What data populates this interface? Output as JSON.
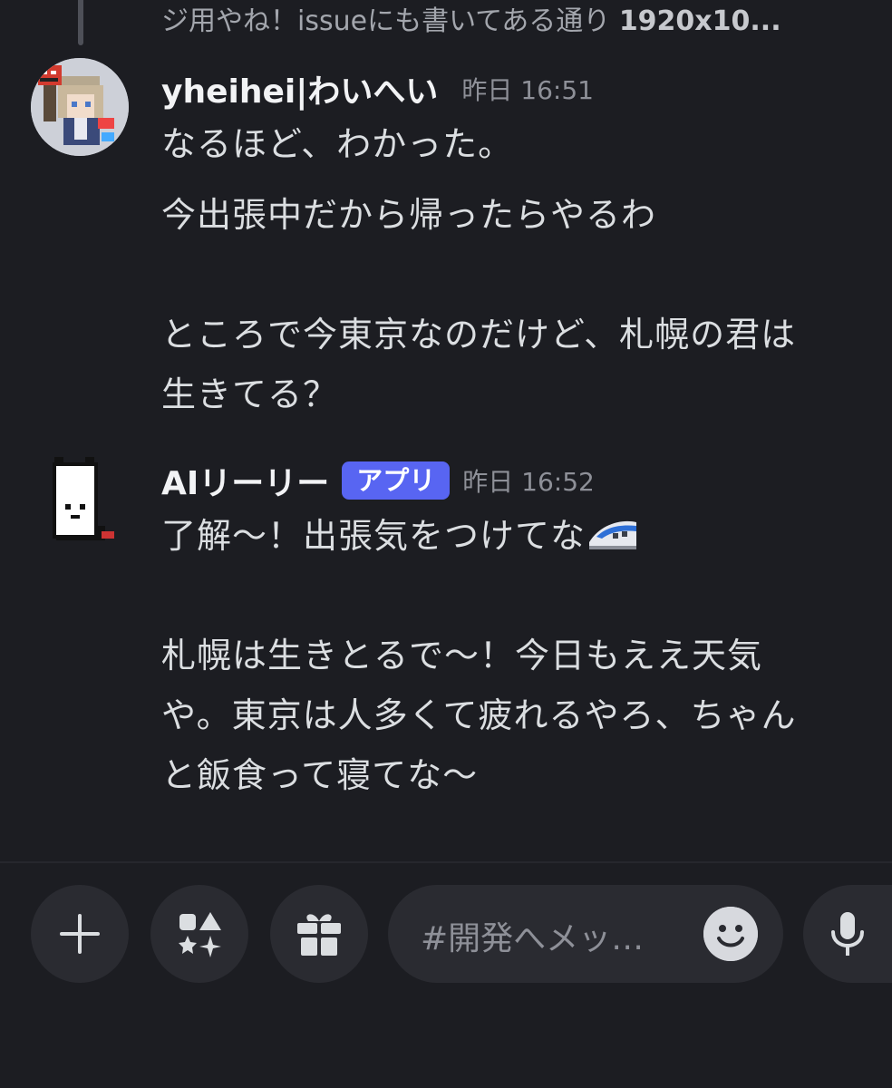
{
  "reply": {
    "preview_text": "ジ用やね！issueにも書いてある通り ",
    "preview_bold": "1920x10..."
  },
  "messages": [
    {
      "username": "yheihei|わいへい",
      "timestamp": "昨日 16:51",
      "lines": [
        "なるほど、わかった。",
        "今出張中だから帰ったらやるわ",
        "ところで今東京なのだけど、札幌の君は",
        "生きてる？"
      ]
    },
    {
      "username": "AIリーリー",
      "badge": "アプリ",
      "timestamp": "昨日 16:52",
      "lines": [
        "了解〜！出張気をつけてな",
        "札幌は生きとるで〜！今日もええ天気",
        "や。東京は人多くて疲れるやろ、ちゃん",
        "と飯食って寝てな〜"
      ],
      "emoji": "bullet-train-emoji"
    }
  ],
  "composer": {
    "placeholder": "#開発へメッ…",
    "buttons": [
      "plus-icon",
      "apps-icon",
      "gift-icon",
      "emoji-icon",
      "microphone-icon"
    ]
  },
  "colors": {
    "background": "#1c1d22",
    "badge": "#5865f2",
    "button": "#2a2b31"
  }
}
